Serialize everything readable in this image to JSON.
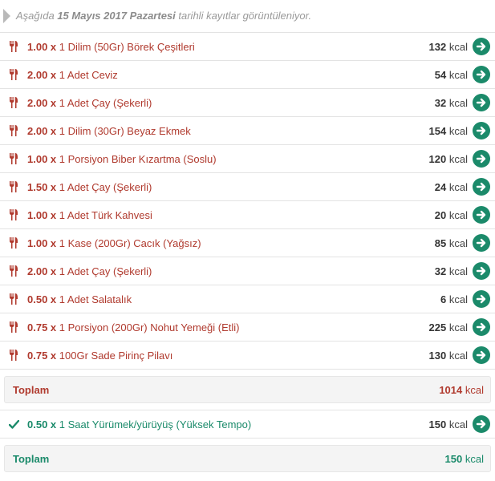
{
  "notice": {
    "prefix": "Aşağıda",
    "date": "15 Mayıs 2017 Pazartesi",
    "suffix": "tarihli kayıtlar görüntüleniyor."
  },
  "food_entries": [
    {
      "qty": "1.00 x",
      "desc": "1 Dilim (50Gr) Börek Çeşitleri",
      "kcal": "132",
      "unit": "kcal"
    },
    {
      "qty": "2.00 x",
      "desc": "1 Adet Ceviz",
      "kcal": "54",
      "unit": "kcal"
    },
    {
      "qty": "2.00 x",
      "desc": "1 Adet Çay (Şekerli)",
      "kcal": "32",
      "unit": "kcal"
    },
    {
      "qty": "2.00 x",
      "desc": "1 Dilim (30Gr) Beyaz Ekmek",
      "kcal": "154",
      "unit": "kcal"
    },
    {
      "qty": "1.00 x",
      "desc": "1 Porsiyon Biber Kızartma (Soslu)",
      "kcal": "120",
      "unit": "kcal"
    },
    {
      "qty": "1.50 x",
      "desc": "1 Adet Çay (Şekerli)",
      "kcal": "24",
      "unit": "kcal"
    },
    {
      "qty": "1.00 x",
      "desc": "1 Adet Türk Kahvesi",
      "kcal": "20",
      "unit": "kcal"
    },
    {
      "qty": "1.00 x",
      "desc": "1 Kase (200Gr) Cacık (Yağsız)",
      "kcal": "85",
      "unit": "kcal"
    },
    {
      "qty": "2.00 x",
      "desc": "1 Adet Çay (Şekerli)",
      "kcal": "32",
      "unit": "kcal"
    },
    {
      "qty": "0.50 x",
      "desc": "1 Adet Salatalık",
      "kcal": "6",
      "unit": "kcal"
    },
    {
      "qty": "0.75 x",
      "desc": "1 Porsiyon (200Gr) Nohut Yemeği (Etli)",
      "kcal": "225",
      "unit": "kcal"
    },
    {
      "qty": "0.75 x",
      "desc": "100Gr Sade Pirinç Pilavı",
      "kcal": "130",
      "unit": "kcal"
    }
  ],
  "food_total": {
    "label": "Toplam",
    "value": "1014",
    "unit": "kcal"
  },
  "exercise_entries": [
    {
      "qty": "0.50 x",
      "desc": "1 Saat Yürümek/yürüyüş (Yüksek Tempo)",
      "kcal": "150",
      "unit": "kcal"
    }
  ],
  "exercise_total": {
    "label": "Toplam",
    "value": "150",
    "unit": "kcal"
  },
  "colors": {
    "food": "#b03a2e",
    "exercise": "#1a8a6a",
    "arrow": "#1b8a6a"
  },
  "icons": {
    "food": "fork-knife-icon",
    "exercise": "checkmark-icon",
    "action": "arrow-right-circle-icon"
  }
}
